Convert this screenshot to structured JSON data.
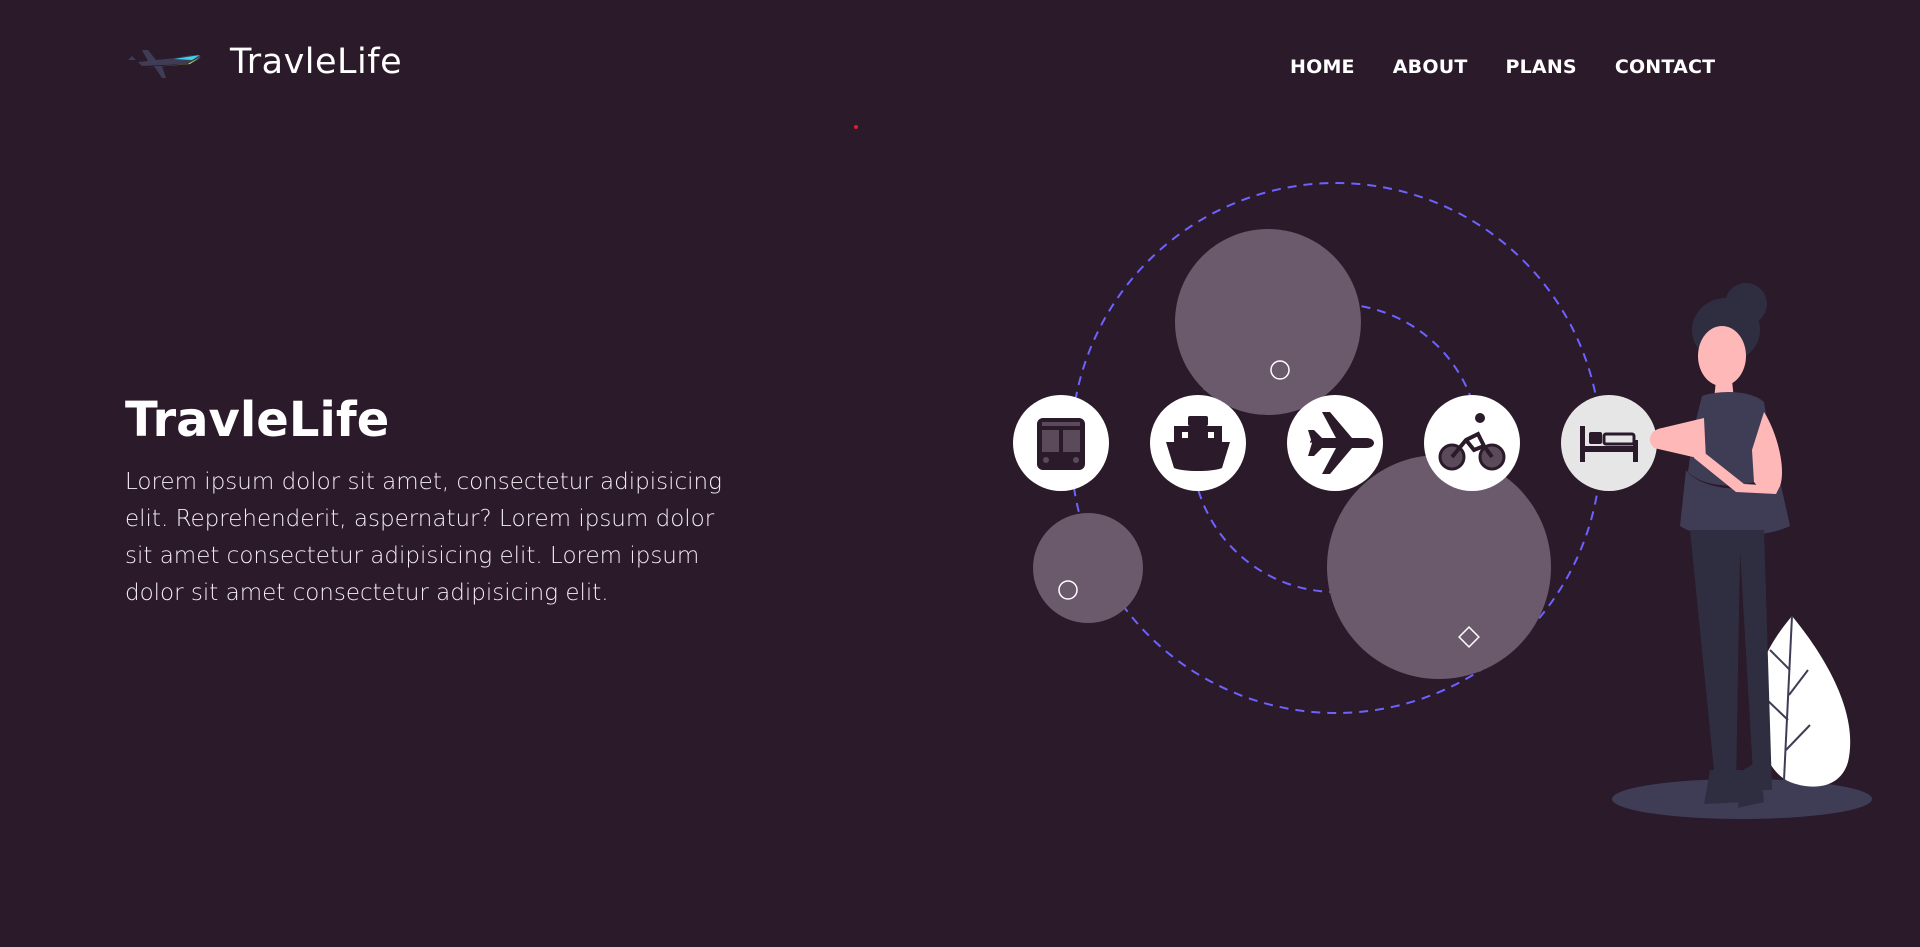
{
  "brand": {
    "name": "TravleLife"
  },
  "nav": {
    "items": [
      {
        "label": "HOME"
      },
      {
        "label": "ABOUT"
      },
      {
        "label": "PLANS"
      },
      {
        "label": "CONTACT"
      }
    ]
  },
  "hero": {
    "title": "TravleLife",
    "text": "Lorem ipsum dolor sit amet, consectetur adipisicing elit. Reprehenderit, aspernatur? Lorem ipsum dolor sit amet consectetur adipisicing elit. Lorem ipsum dolor sit amet consectetur adipisicing elit."
  },
  "illustration": {
    "icons": [
      "bus-icon",
      "ship-icon",
      "airplane-icon",
      "bicycle-icon",
      "bed-icon"
    ]
  },
  "colors": {
    "background": "#2a1a2a",
    "accent_dashed": "#6c63ff",
    "bubble": "#6b5a6b",
    "figure_dark": "#3f3d56",
    "skin": "#ffb8b8"
  }
}
